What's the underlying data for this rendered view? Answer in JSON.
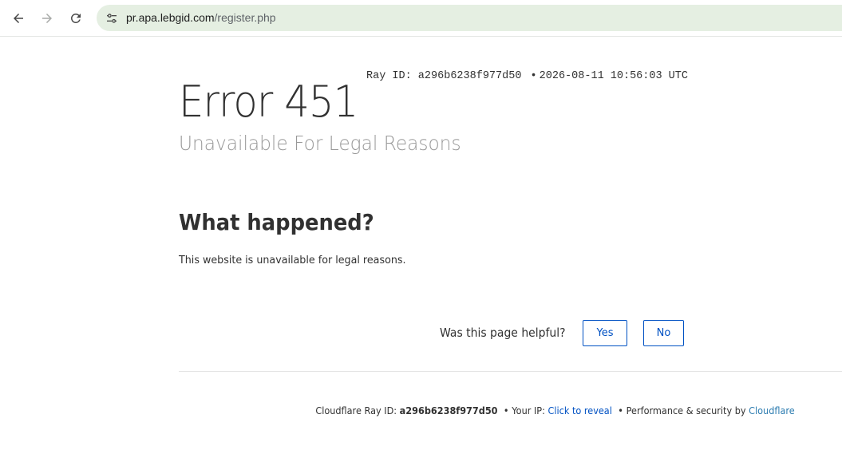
{
  "browser": {
    "url_host": "pr.apa.lebgid.com",
    "url_path": "/register.php",
    "icons": {
      "back": "arrow-left-icon",
      "forward": "arrow-right-icon",
      "reload": "reload-icon",
      "site_info": "tune-icon"
    }
  },
  "error": {
    "code": "Error 451",
    "ray_label": "Ray ID: a296b6238f977d50",
    "bullet": "•",
    "timestamp": "2026-08-11 10:56:03 UTC",
    "subtitle": "Unavailable For Legal Reasons"
  },
  "what_happened": {
    "heading": "What happened?",
    "text": "This website is unavailable for legal reasons."
  },
  "feedback": {
    "question": "Was this page helpful?",
    "yes_label": "Yes",
    "no_label": "No",
    "accent": "#0051c3"
  },
  "footer": {
    "ray_prefix": "Cloudflare Ray ID:",
    "ray_id": "a296b6238f977d50",
    "bullet": "•",
    "ip_prefix": "Your IP:",
    "ip_link": "Click to reveal",
    "perf_prefix": "Performance & security by",
    "cloudflare_link": "Cloudflare"
  }
}
